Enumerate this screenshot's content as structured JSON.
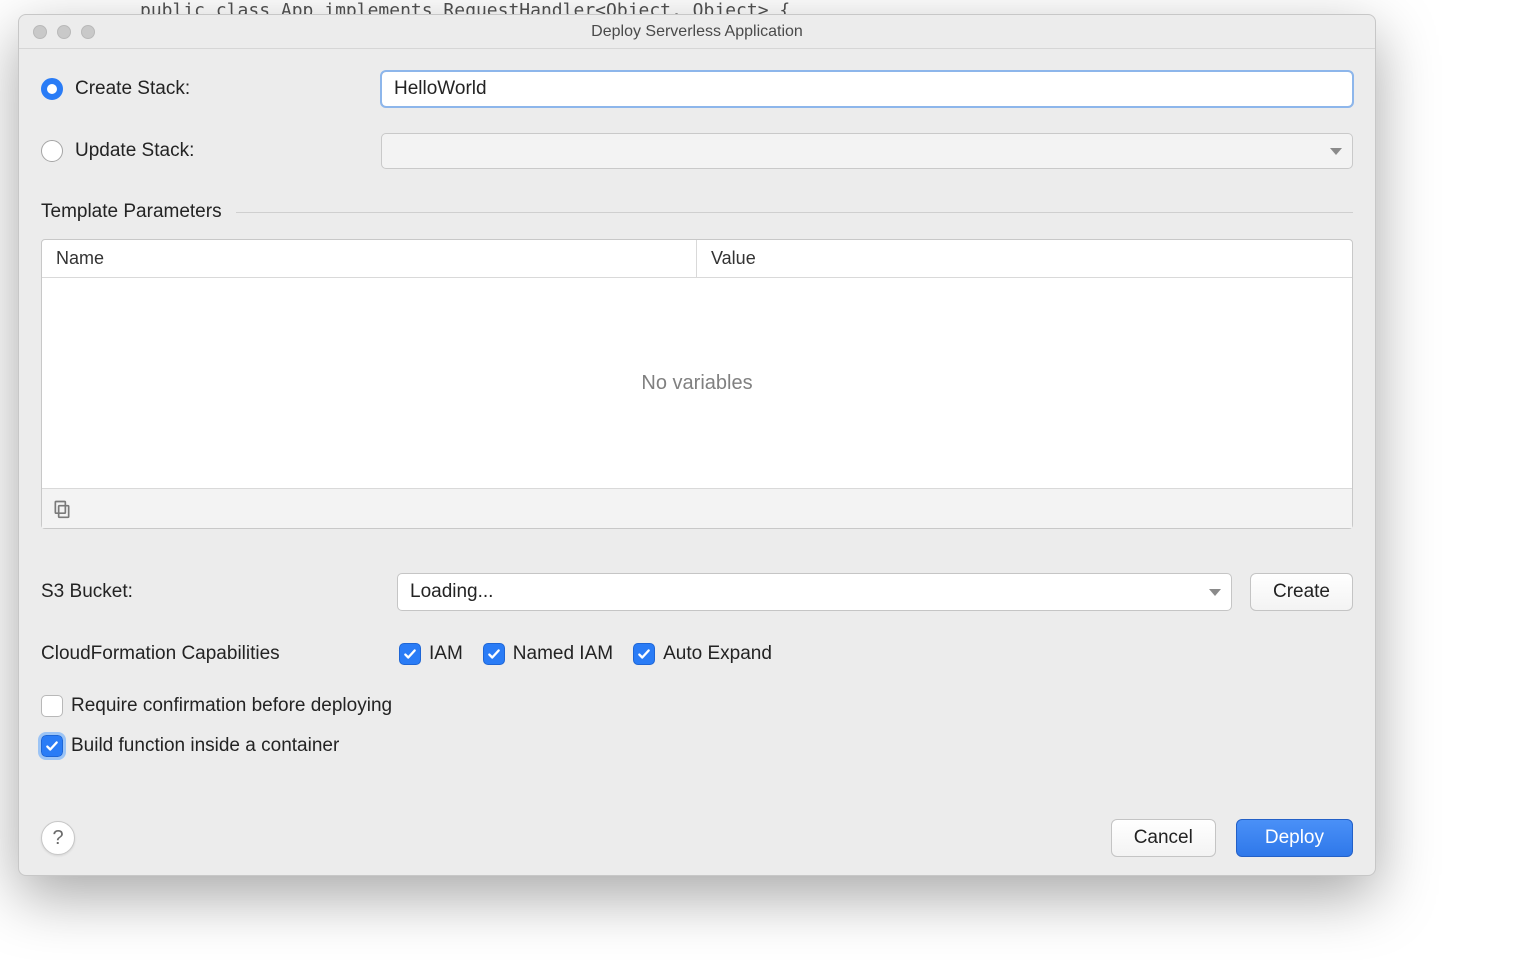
{
  "window": {
    "title": "Deploy Serverless Application"
  },
  "bg_code": "public class App implements RequestHandler<Object, Object> {",
  "stack": {
    "create_label": "Create Stack:",
    "create_value": "HelloWorld",
    "create_selected": true,
    "update_label": "Update Stack:",
    "update_value": "",
    "update_selected": false
  },
  "params": {
    "section_label": "Template Parameters",
    "columns": {
      "name": "Name",
      "value": "Value"
    },
    "empty_text": "No variables"
  },
  "s3": {
    "label": "S3 Bucket:",
    "value": "Loading...",
    "create_btn": "Create"
  },
  "caps": {
    "label": "CloudFormation Capabilities",
    "iam": {
      "label": "IAM",
      "checked": true
    },
    "named_iam": {
      "label": "Named IAM",
      "checked": true
    },
    "auto_expand": {
      "label": "Auto Expand",
      "checked": true
    }
  },
  "opts": {
    "confirm": {
      "label": "Require confirmation before deploying",
      "checked": false
    },
    "container": {
      "label": "Build function inside a container",
      "checked": true,
      "focused": true
    }
  },
  "footer": {
    "help": "?",
    "cancel": "Cancel",
    "deploy": "Deploy"
  }
}
